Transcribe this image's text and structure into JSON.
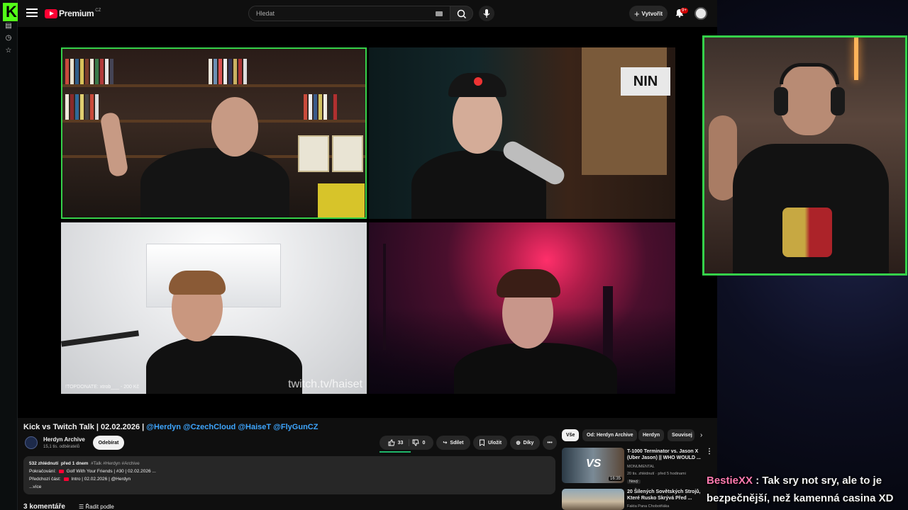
{
  "youtube": {
    "brand": "Premium",
    "brand_country": "CZ",
    "search_placeholder": "Hledat",
    "create_label": "Vytvořit",
    "notification_count": "9+"
  },
  "video": {
    "title": "Kick vs Twitch Talk | 02.02.2026 |",
    "title_tags": "@Herdyn @CzechCloud @HaiseT @FlyGunCZ",
    "watermark": "twitch.tv/haiset",
    "donate_text": "!TOPDONATE: xtrob___ - 200 Kč"
  },
  "channel": {
    "name": "Herdyn Archive",
    "subscribers": "15,1 tis. odběratelů",
    "subscribe_label": "Odebírat"
  },
  "actions": {
    "likes": "33",
    "dislikes": "0",
    "share": "Sdílet",
    "save": "Uložit",
    "thanks": "Díky"
  },
  "description": {
    "views": "532 zhlédnutí",
    "age": "před 1 dnem",
    "hashtags": "#Talk #Herdyn #Archive",
    "continue_label": "Pokračování:",
    "continue_text": "Golf With Your Friends | #30 | 02.02.2026 ...",
    "prev_label": "Předchozí část:",
    "prev_text": "Intro | 02.02.2026 | @Herdyn",
    "more": "...více"
  },
  "comments": {
    "count": "3 komentáře",
    "sort": "Řadit podle"
  },
  "chips": [
    "Vše",
    "Od: Herdyn Archive",
    "Herdyn",
    "Souvisej"
  ],
  "recommendations": [
    {
      "title": "T-1000 Terminator vs. Jason X (Uber Jason) || WHO WOULD ...",
      "channel": "MONUMENTAL",
      "meta": "20 tis. zhlédnutí · před 5 hodinami",
      "badge": "Nový",
      "duration": "16:35",
      "thumb_text": "VS"
    },
    {
      "title": "20 Šílených Sovětských Strojů, Které Rusko Skrývá Před ...",
      "channel": "Fakta Pana Chobotňáka"
    }
  ],
  "chat": {
    "user": "BestieXX",
    "message": " : Tak sry not sry, ale to je bezpečnější, než kamenná casina XD"
  }
}
